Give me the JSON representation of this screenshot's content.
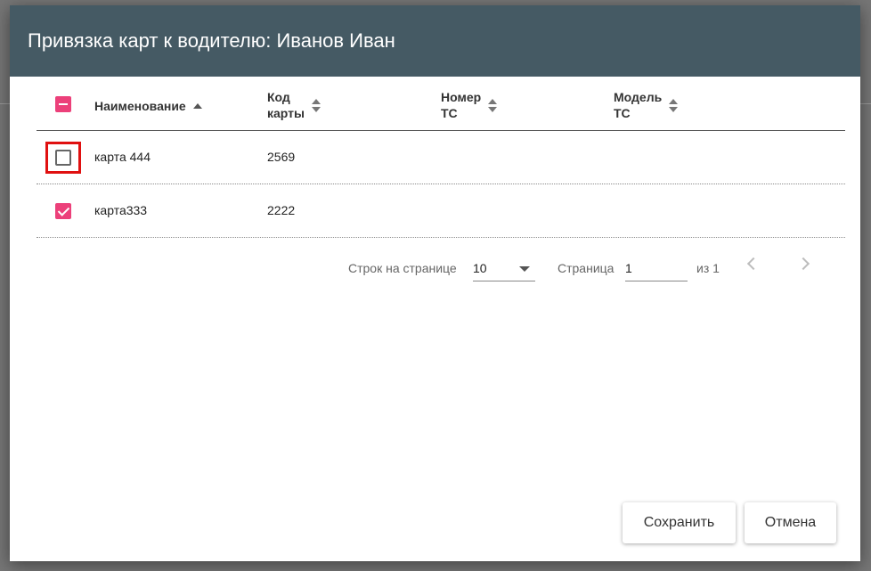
{
  "dialog": {
    "title": "Привязка карт к водителю: Иванов Иван"
  },
  "table": {
    "columns": [
      {
        "label": "Наименование",
        "sort": "ascending"
      },
      {
        "label": "Код\nкарты",
        "sort": "none"
      },
      {
        "label": "Номер\nТС",
        "sort": "none"
      },
      {
        "label": "Модель\nТС",
        "sort": "none"
      }
    ],
    "header_checkbox_state": "indeterminate",
    "rows": [
      {
        "checked": false,
        "highlighted": true,
        "name": "карта 444",
        "code": "2569",
        "vehicle_number": "",
        "vehicle_model": ""
      },
      {
        "checked": true,
        "highlighted": false,
        "name": "карта333",
        "code": "2222",
        "vehicle_number": "",
        "vehicle_model": ""
      }
    ]
  },
  "pagination": {
    "rows_per_page_label": "Строк на странице",
    "rows_per_page_value": "10",
    "page_label": "Страница",
    "page_value": "1",
    "total_label": "из 1"
  },
  "actions": {
    "save_label": "Сохранить",
    "cancel_label": "Отмена"
  },
  "colors": {
    "header_bg": "#455a64",
    "accent": "#ec407a",
    "highlight": "#e01010"
  }
}
